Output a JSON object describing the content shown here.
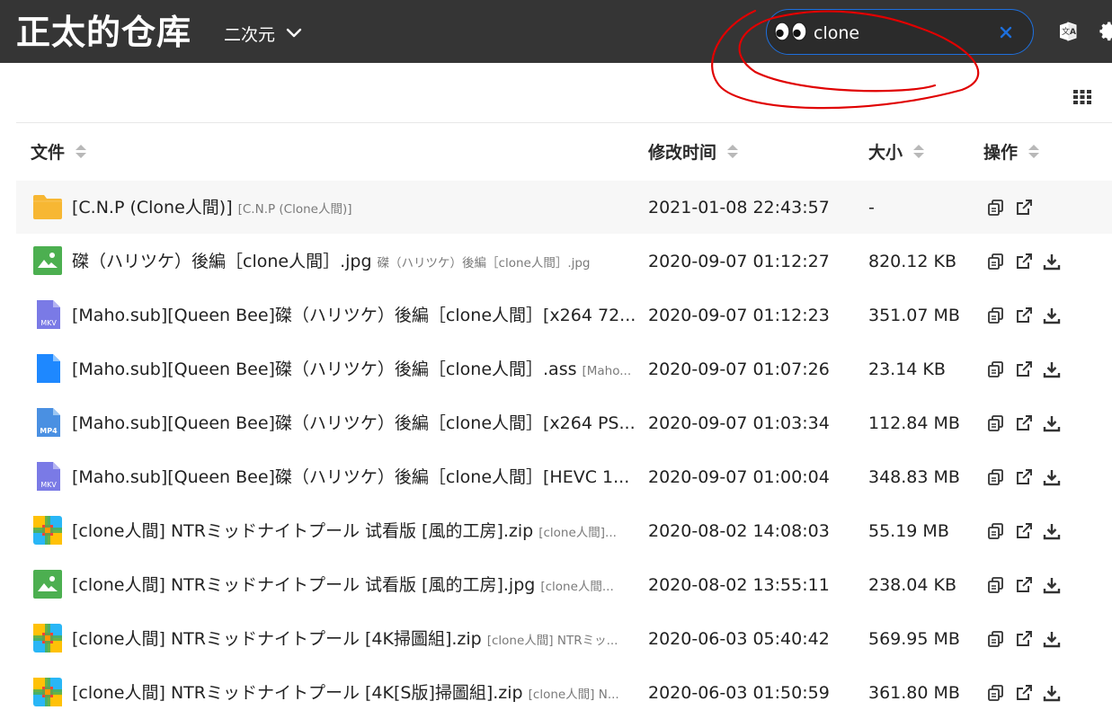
{
  "header": {
    "site_title": "正太的仓库",
    "category_label": "二次元",
    "search_value": "clone"
  },
  "colors": {
    "header_bg": "#353535",
    "search_border": "#1e6fdc",
    "annotation_red": "#e00000",
    "folder": "#f7b733",
    "image": "#4caf50",
    "mkv": "#7a7ae6",
    "mp4": "#4a90e2",
    "ass": "#1e88ff"
  },
  "table": {
    "columns": [
      "文件",
      "修改时间",
      "大小",
      "操作"
    ],
    "rows": [
      {
        "icon": "folder-icon",
        "name": "[C.N.P (Clone人間)]",
        "sub": "[C.N.P (Clone人間)]",
        "time": "2021-01-08 22:43:57",
        "size": "-",
        "download": false
      },
      {
        "icon": "image-file-icon",
        "name": "磔（ハリツケ）後編［clone人間］.jpg",
        "sub": "磔（ハリツケ）後編［clone人間］.jpg",
        "time": "2020-09-07 01:12:27",
        "size": "820.12 KB",
        "download": true
      },
      {
        "icon": "mkv-file-icon",
        "name": "[Maho.sub][Queen Bee]磔（ハリツケ）後編［clone人間］[x264 72...",
        "sub": "",
        "time": "2020-09-07 01:12:23",
        "size": "351.07 MB",
        "download": true
      },
      {
        "icon": "generic-file-icon",
        "name": "[Maho.sub][Queen Bee]磔（ハリツケ）後編［clone人間］.ass",
        "sub": "[Maho...",
        "time": "2020-09-07 01:07:26",
        "size": "23.14 KB",
        "download": true
      },
      {
        "icon": "mp4-file-icon",
        "name": "[Maho.sub][Queen Bee]磔（ハリツケ）後編［clone人間］[x264 PS...",
        "sub": "",
        "time": "2020-09-07 01:03:34",
        "size": "112.84 MB",
        "download": true
      },
      {
        "icon": "mkv-file-icon",
        "name": "[Maho.sub][Queen Bee]磔（ハリツケ）後編［clone人間］[HEVC 1...",
        "sub": "",
        "time": "2020-09-07 01:00:04",
        "size": "348.83 MB",
        "download": true
      },
      {
        "icon": "zip-file-icon",
        "name": "[clone人間] NTRミッドナイトプール 试看版 [風的工房].zip",
        "sub": "[clone人間]...",
        "time": "2020-08-02 14:08:03",
        "size": "55.19 MB",
        "download": true
      },
      {
        "icon": "image-file-icon",
        "name": "[clone人間] NTRミッドナイトプール 试看版 [風的工房].jpg",
        "sub": "[clone人間...",
        "time": "2020-08-02 13:55:11",
        "size": "238.04 KB",
        "download": true
      },
      {
        "icon": "zip-file-icon",
        "name": "[clone人間] NTRミッドナイトプール [4K掃圖組].zip",
        "sub": "[clone人間] NTRミッ...",
        "time": "2020-06-03 05:40:42",
        "size": "569.95 MB",
        "download": true
      },
      {
        "icon": "zip-file-icon",
        "name": "[clone人間] NTRミッドナイトプール [4K[S版]掃圖組].zip",
        "sub": "[clone人間] N...",
        "time": "2020-06-03 01:50:59",
        "size": "361.80 MB",
        "download": true
      }
    ]
  }
}
